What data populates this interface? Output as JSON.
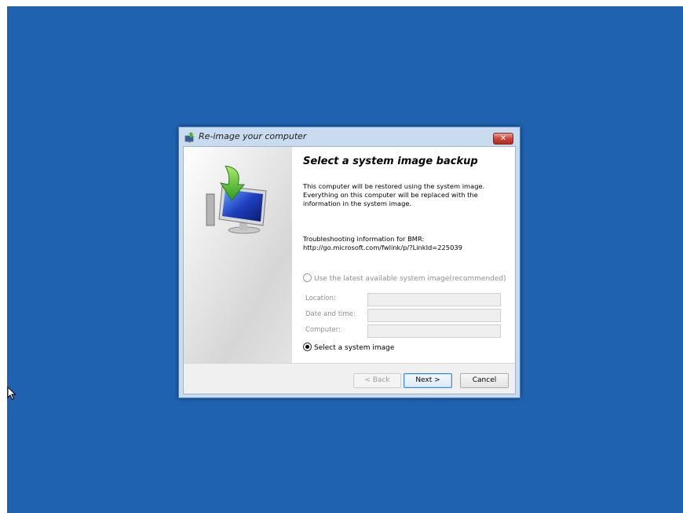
{
  "window": {
    "title": "Re-image your computer",
    "icon": "backup-restore-icon",
    "close_label": "✕"
  },
  "content": {
    "heading": "Select a system image backup",
    "description": "This computer will be restored using the system image.\nEverything on this computer will be replaced with the\ninformation in the system image.",
    "troubleshooting": "Troubleshooting information for BMR:\nhttp://go.microsoft.com/fwlink/p/?LinkId=225039"
  },
  "options": {
    "latest": {
      "label": "Use the latest available system image(recommended)",
      "enabled": false,
      "selected": false
    },
    "select": {
      "label": "Select a system image",
      "enabled": true,
      "selected": true
    }
  },
  "fields": {
    "location_label": "Location:",
    "location_value": "",
    "datetime_label": "Date and time:",
    "datetime_value": "",
    "computer_label": "Computer:",
    "computer_value": ""
  },
  "buttons": {
    "back": "< Back",
    "next": "Next >",
    "cancel": "Cancel"
  },
  "colors": {
    "desktop": "#1f63b0",
    "accent": "#3c8fd6",
    "close": "#c9463a"
  }
}
